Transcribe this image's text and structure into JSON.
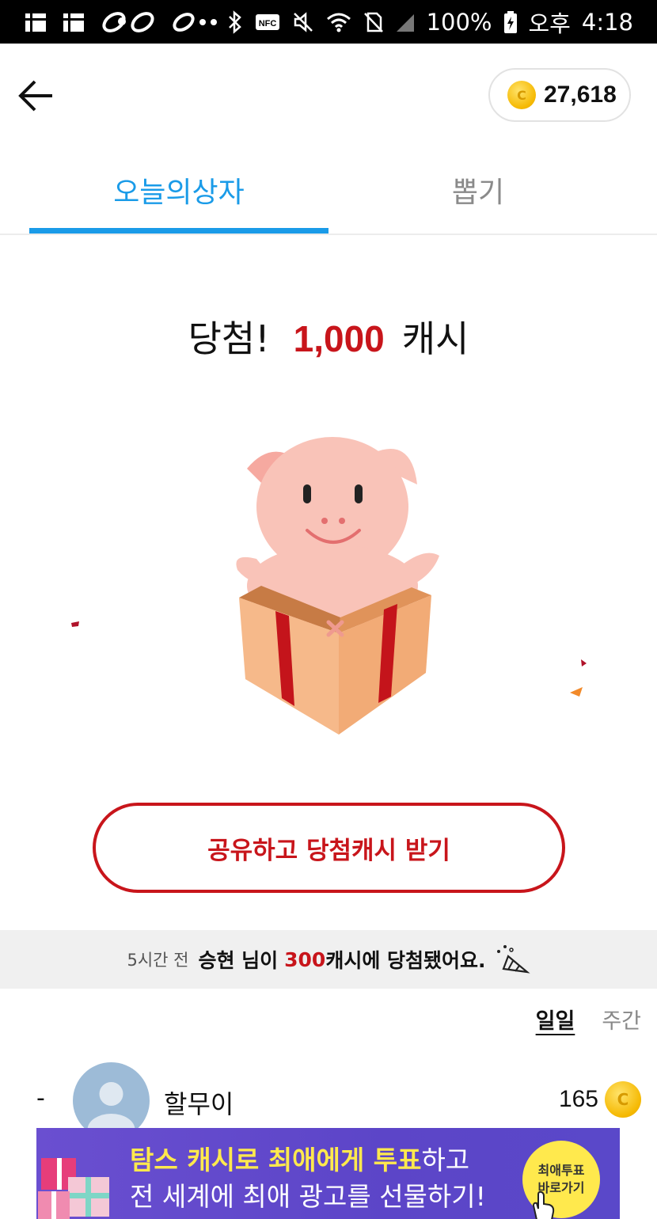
{
  "status_bar": {
    "battery": "100%",
    "period": "오후",
    "time": "4:18",
    "nfc": "NFC"
  },
  "header": {
    "coin_balance": "27,618",
    "coin_symbol": "C"
  },
  "tabs": [
    {
      "label": "오늘의상자",
      "active": true
    },
    {
      "label": "뽑기",
      "active": false
    }
  ],
  "result": {
    "prefix": "당첨!",
    "amount": "1,000",
    "unit": "캐시"
  },
  "cta": {
    "label": "공유하고 당첨캐시 받기"
  },
  "notice": {
    "time": "5시간 전",
    "name": "승현 님이",
    "points": "300",
    "suffix": "캐시에 당첨됐어요."
  },
  "period": {
    "daily": "일일",
    "weekly": "주간"
  },
  "ranking": [
    {
      "rank": "-",
      "name": "할무이",
      "score": "165"
    }
  ],
  "ad": {
    "line1_highlight": "탐스 캐시로 최애에게 투표",
    "line1_rest": "하고",
    "line2": "전 세계에 최애 광고를 선물하기!",
    "badge_line1": "최애투표",
    "badge_line2": "바로가기"
  },
  "colors": {
    "accent_blue": "#1a9be8",
    "accent_red": "#c8151b",
    "ad_purple": "#5c45c8",
    "ad_yellow": "#ffe94d"
  }
}
